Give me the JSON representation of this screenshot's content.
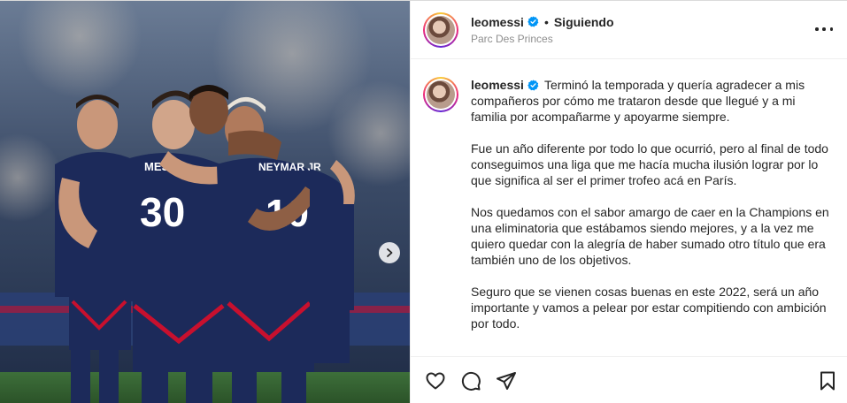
{
  "header": {
    "username": "leomessi",
    "separator": "•",
    "follow_status": "Siguiendo",
    "location": "Parc Des Princes"
  },
  "caption": {
    "username": "leomessi",
    "paragraphs": [
      "Terminó la temporada y quería agradecer a mis compañeros por cómo me trataron desde que llegué y a mi familia por acompañarme y apoyarme siempre.",
      "Fue un año diferente por todo lo que ocurrió, pero al final de todo conseguimos una liga que me hacía mucha ilusión lograr por lo que significa al ser el primer trofeo acá en París.",
      "Nos quedamos con el sabor amargo de caer en la Champions en una eliminatoria que estábamos siendo mejores, y a la vez me quiero quedar con la alegría de haber sumado otro título que era también uno de los objetivos.",
      "Seguro que se vienen cosas buenas en este 2022, será un año importante y vamos a pelear por estar compitiendo con ambición por todo."
    ]
  },
  "photo": {
    "jersey_numbers": [
      "30",
      "10"
    ],
    "jersey_names": [
      "MESSI",
      "NEYMAR JR"
    ]
  },
  "icons": {
    "verified": "verified-badge-icon",
    "more": "more-options-icon",
    "like": "heart-icon",
    "comment": "comment-icon",
    "share": "paper-plane-icon",
    "save": "bookmark-icon",
    "next": "chevron-right-icon"
  },
  "colors": {
    "verified": "#0095f6",
    "text": "#262626",
    "secondary": "#8e8e8e",
    "jersey": "#1c2a5a",
    "jersey_stripe": "#c8102e"
  }
}
